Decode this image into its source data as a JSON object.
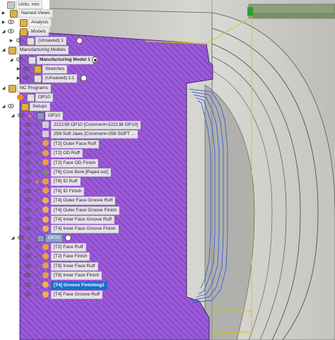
{
  "browser": {
    "units": "Units: mm",
    "named_views": "Named Views",
    "analysis": "Analysis",
    "models": "Models",
    "unsaved_1": "(Unsaved):1",
    "mfg_models": "Manufacturing Models",
    "mfg_model_1": "Manufacturing Model 1",
    "sketches": "Sketches",
    "unsaved_1_1": "(Unsaved):1:1",
    "nc_programs": "NC Programs",
    "op10_program": "OP10",
    "setups": "Setups",
    "setup_op10": "OP10",
    "setup_op20": "OP20",
    "op10_items": [
      {
        "label": "222138 OP10 [Comment=222138 OP10]",
        "status": "ok",
        "icon": "comment-icon"
      },
      {
        "label": "256 Soft Jaws [Comment=256 SOFT ...",
        "status": "ok",
        "icon": "comment-icon"
      },
      {
        "label": "[T2] Outer Face Ruff",
        "status": "ok",
        "icon": "turning-tool-icon"
      },
      {
        "label": "[T2] OD Ruff",
        "status": "ok",
        "icon": "turning-tool-icon"
      },
      {
        "label": "[T2] Face OD Finish",
        "status": "ok",
        "icon": "turning-tool-icon"
      },
      {
        "label": "[T6] Core Bore [Rapid out]",
        "status": "ok",
        "icon": "drill-icon"
      },
      {
        "label": "[T8] ID Ruff",
        "status": "warning",
        "icon": "boring-tool-icon"
      },
      {
        "label": "[T8] ID Finish",
        "status": "ok",
        "icon": "boring-tool-icon"
      },
      {
        "label": "[T4] Outer Face Groove Ruff",
        "status": "ok",
        "icon": "groove-tool-icon"
      },
      {
        "label": "[T4] Outer Face Groove Finish",
        "status": "ok",
        "icon": "groove-tool-icon"
      },
      {
        "label": "[T4] Inner Face Groove Ruff",
        "status": "ok",
        "icon": "groove-tool-icon"
      },
      {
        "label": "[T4] Inner Face Groove Finish",
        "status": "ok",
        "icon": "groove-tool-icon"
      }
    ],
    "op20_items": [
      {
        "label": "[T2] Face Ruff",
        "status": "ok",
        "icon": "turning-tool-icon"
      },
      {
        "label": "[T2] Face Finish",
        "status": "ok",
        "icon": "turning-tool-icon"
      },
      {
        "label": "[T8] Inner Face Ruff",
        "status": "ok",
        "icon": "boring-tool-icon"
      },
      {
        "label": "[T8] Inner Face Finish",
        "status": "ok",
        "icon": "boring-tool-icon"
      },
      {
        "label": "[T4] Groove Finishing1",
        "status": "ok",
        "icon": "groove-tool-icon",
        "selected": true
      },
      {
        "label": "[T4] Face Groove Ruff",
        "status": "ok",
        "icon": "groove-tool-icon"
      }
    ]
  },
  "colors": {
    "stock": "#9b59d9",
    "hatch": "#3a2060",
    "part": "#c8c8c4",
    "toolpath": "#3a5fd0",
    "rapid": "#d8c800",
    "selection": "#1a6fd0",
    "ok_check": "#2c8c2c",
    "warning": "#e59b00"
  }
}
